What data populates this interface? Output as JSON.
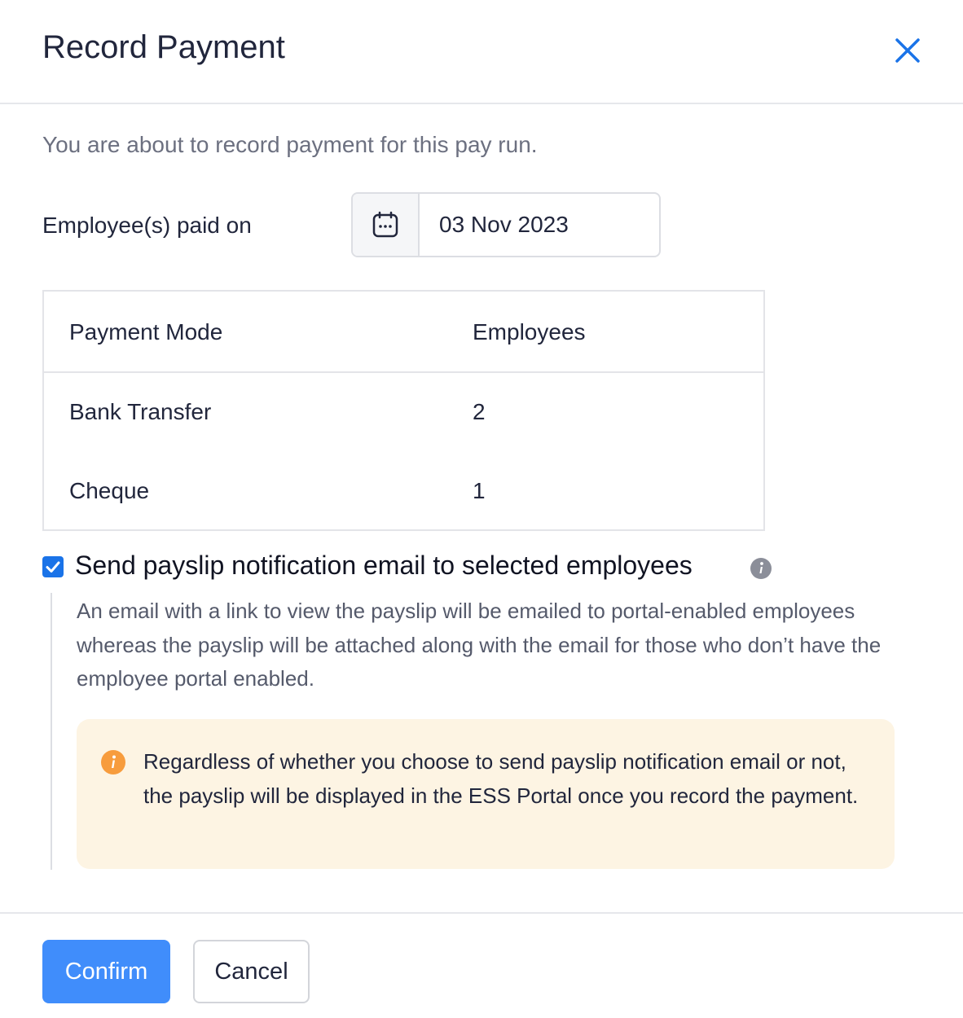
{
  "dialog": {
    "title": "Record Payment",
    "intro": "You are about to record payment for this pay run."
  },
  "paid_on": {
    "label": "Employee(s) paid on",
    "date": "03 Nov 2023"
  },
  "payment_table": {
    "headers": [
      "Payment Mode",
      "Employees"
    ],
    "rows": [
      {
        "mode": "Bank Transfer",
        "employees": "2"
      },
      {
        "mode": "Cheque",
        "employees": "1"
      }
    ]
  },
  "notification": {
    "checked": true,
    "label": "Send payslip notification email to selected employees",
    "description": "An email with a link to view the payslip will be emailed to portal-enabled employees whereas the payslip will be attached along with the email for those who don’t have the employee portal enabled.",
    "note": "Regardless of whether you choose to send payslip notification email or not, the payslip will be displayed in the ESS Portal once you record the payment."
  },
  "footer": {
    "confirm_label": "Confirm",
    "cancel_label": "Cancel"
  },
  "colors": {
    "accent": "#408dfb",
    "checkbox": "#1a73e8",
    "note_bg": "#fdf4e3",
    "warning_icon": "#f79c3d"
  },
  "icons": {
    "close": "close-icon",
    "calendar": "calendar-icon",
    "info": "info-icon",
    "warning": "warning-info-icon",
    "check": "checkmark-icon"
  }
}
